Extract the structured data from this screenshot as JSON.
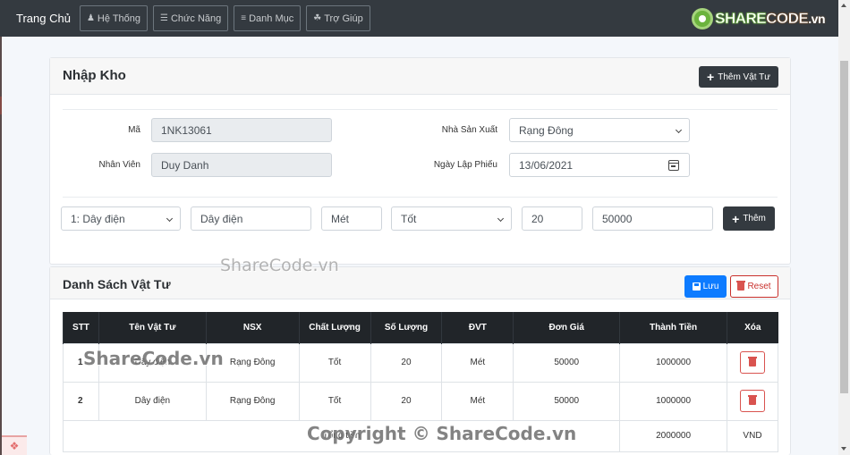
{
  "navbar": {
    "brand": "Trang Chủ",
    "items": [
      {
        "label": "Hệ Thống",
        "icon": "users-cog-icon"
      },
      {
        "label": "Chức Năng",
        "icon": "coins-icon"
      },
      {
        "label": "Danh Mục",
        "icon": "bars-icon"
      },
      {
        "label": "Trợ Giúp",
        "icon": "handshake-icon"
      }
    ],
    "logo": {
      "part1": "SHARE",
      "part2": "CODE",
      "part3": ".vn"
    }
  },
  "import_card": {
    "title": "Nhập Kho",
    "add_material_button": "Thêm Vật Tư",
    "fields": {
      "code": {
        "label": "Mã",
        "value": "1NK13061"
      },
      "employee": {
        "label": "Nhân Viên",
        "value": "Duy Danh"
      },
      "manufacturer": {
        "label": "Nhà Sản Xuất",
        "value": "Rạng Đông"
      },
      "date": {
        "label": "Ngày Lập Phiếu",
        "value": "13/06/2021"
      }
    },
    "item_row": {
      "material_select": "1: Dây điện",
      "material_name": "Dây điện",
      "unit": "Mét",
      "quality_select": "Tốt",
      "quantity": "20",
      "price": "50000",
      "add_button": "Thêm"
    }
  },
  "list_card": {
    "title": "Danh Sách Vật Tư",
    "save_button": "Lưu",
    "reset_button": "Reset",
    "columns": [
      "STT",
      "Tên Vật Tư",
      "NSX",
      "Chất Lượng",
      "Số Lượng",
      "ĐVT",
      "Đơn Giá",
      "Thành Tiền",
      "Xóa"
    ],
    "rows": [
      {
        "stt": "1",
        "name": "Dây điện",
        "nsx": "Rạng Đông",
        "quality": "Tốt",
        "qty": "20",
        "unit": "Mét",
        "price": "50000",
        "total": "1000000"
      },
      {
        "stt": "2",
        "name": "Dây điện",
        "nsx": "Rạng Đông",
        "quality": "Tốt",
        "qty": "20",
        "unit": "Mét",
        "price": "50000",
        "total": "1000000"
      }
    ],
    "footer": {
      "label": "Tổng tiền",
      "total": "2000000",
      "currency": "VND"
    }
  },
  "watermarks": {
    "top": "ShareCode.vn",
    "row": "ShareCode.vn",
    "copyright": "Copyright © ShareCode.vn"
  }
}
